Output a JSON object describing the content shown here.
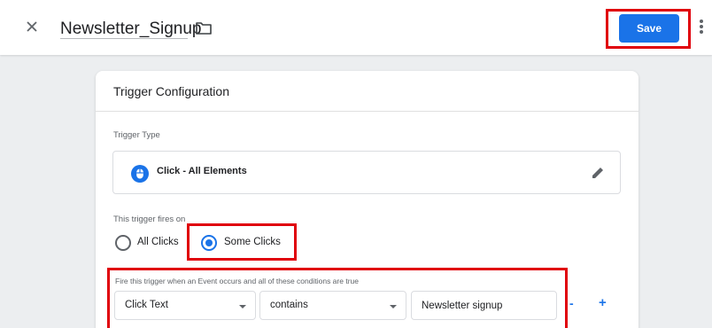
{
  "header": {
    "close_icon": "close-icon",
    "title": "Newsletter_Signup",
    "folder_icon": "folder-icon",
    "save_label": "Save",
    "more_icon": "more-vert-icon"
  },
  "card": {
    "title": "Trigger Configuration",
    "trigger_type": {
      "label": "Trigger Type",
      "value": "Click - All Elements",
      "icon": "mouse-icon",
      "edit_icon": "edit-pencil-icon"
    },
    "fires_on": {
      "label": "This trigger fires on",
      "options": [
        {
          "label": "All Clicks",
          "checked": false
        },
        {
          "label": "Some Clicks",
          "checked": true
        }
      ]
    },
    "conditions": {
      "label": "Fire this trigger when an Event occurs and all of these conditions are true",
      "variable": "Click Text",
      "operator": "contains",
      "value": "Newsletter signup",
      "remove_label": "-",
      "add_label": "+"
    }
  },
  "colors": {
    "accent": "#1a73e8",
    "highlight": "#e0000a",
    "background": "#eceef0"
  }
}
